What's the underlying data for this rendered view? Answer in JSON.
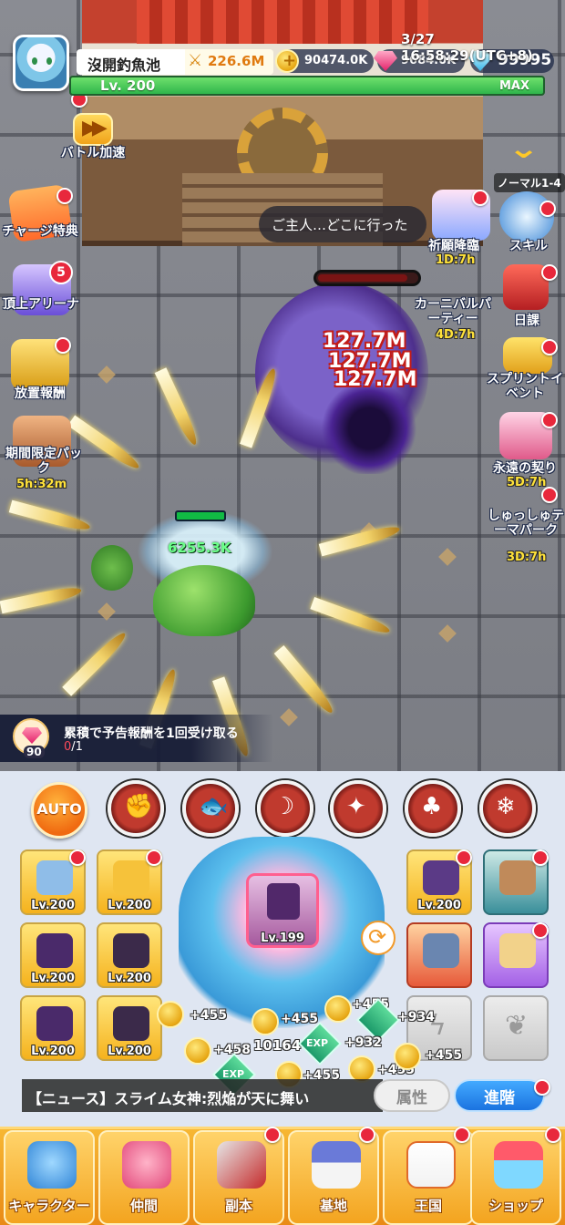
{
  "hud": {
    "player_name": "沒開釣魚池",
    "power": "226.6M",
    "coins": "90474.0K",
    "pink_gems": "9684.0K",
    "diamonds": "99995",
    "datetime": "3/27 16:58:29(UTC+8)",
    "level": "Lv. 200",
    "level_max": "MAX"
  },
  "left_menu": {
    "battle_speed": "バトル加速",
    "charge_bonus": "チャージ特典",
    "top_arena": "頂上アリーナ",
    "top_arena_badge": "5",
    "idle_reward": "放置報酬",
    "limited_pack": "期間限定パック",
    "limited_pack_timer": "5h:32m"
  },
  "right_menu": {
    "stage": "ノーマル1-4",
    "wish": "祈願降臨",
    "wish_timer": "1D:7h",
    "skill": "スキル",
    "carnival": "カーニバルパーティー",
    "carnival_timer": "4D:7h",
    "daily": "日課",
    "sprint": "スプリントイベント",
    "eternal": "永遠の契り",
    "eternal_timer": "5D:7h",
    "theme_park": "しゅっしゅテーマパーク",
    "theme_park_timer": "3D:7h"
  },
  "battle": {
    "speech": "ご主人…どこに行った",
    "damage_1": "127.7M",
    "damage_2": "127.7M",
    "damage_3": "127.7M",
    "heal": "6255.3K"
  },
  "notice": {
    "gem_count": "90",
    "text": "累積で予告報酬を1回受け取る",
    "progress_current": "0",
    "progress_total": "/1"
  },
  "skills": {
    "auto": "AUTO",
    "icons": [
      "arm-icon",
      "beast-icon",
      "slash-icon",
      "shadow-icon",
      "broccoli-icon",
      "ice-icon"
    ]
  },
  "equipment": {
    "level_label": "Lv.200",
    "gacha_level": "Lv.199"
  },
  "floating": {
    "plus455": "+455",
    "plus458": "+458",
    "plus932": "+932",
    "plus934": "+934",
    "combo": "10164",
    "exp": "EXP"
  },
  "bottom": {
    "news": "【ニュース】スライム女神:烈焔が天に舞い",
    "attribute": "属性",
    "advance": "進階",
    "tabs": [
      "キャラクター",
      "仲間",
      "副本",
      "基地",
      "王国",
      "ショップ"
    ]
  },
  "colors": {
    "accent_orange": "#f3a41f",
    "level_green": "#2fb54b",
    "notify_red": "#e8283c",
    "advance_blue": "#1b73e0"
  }
}
